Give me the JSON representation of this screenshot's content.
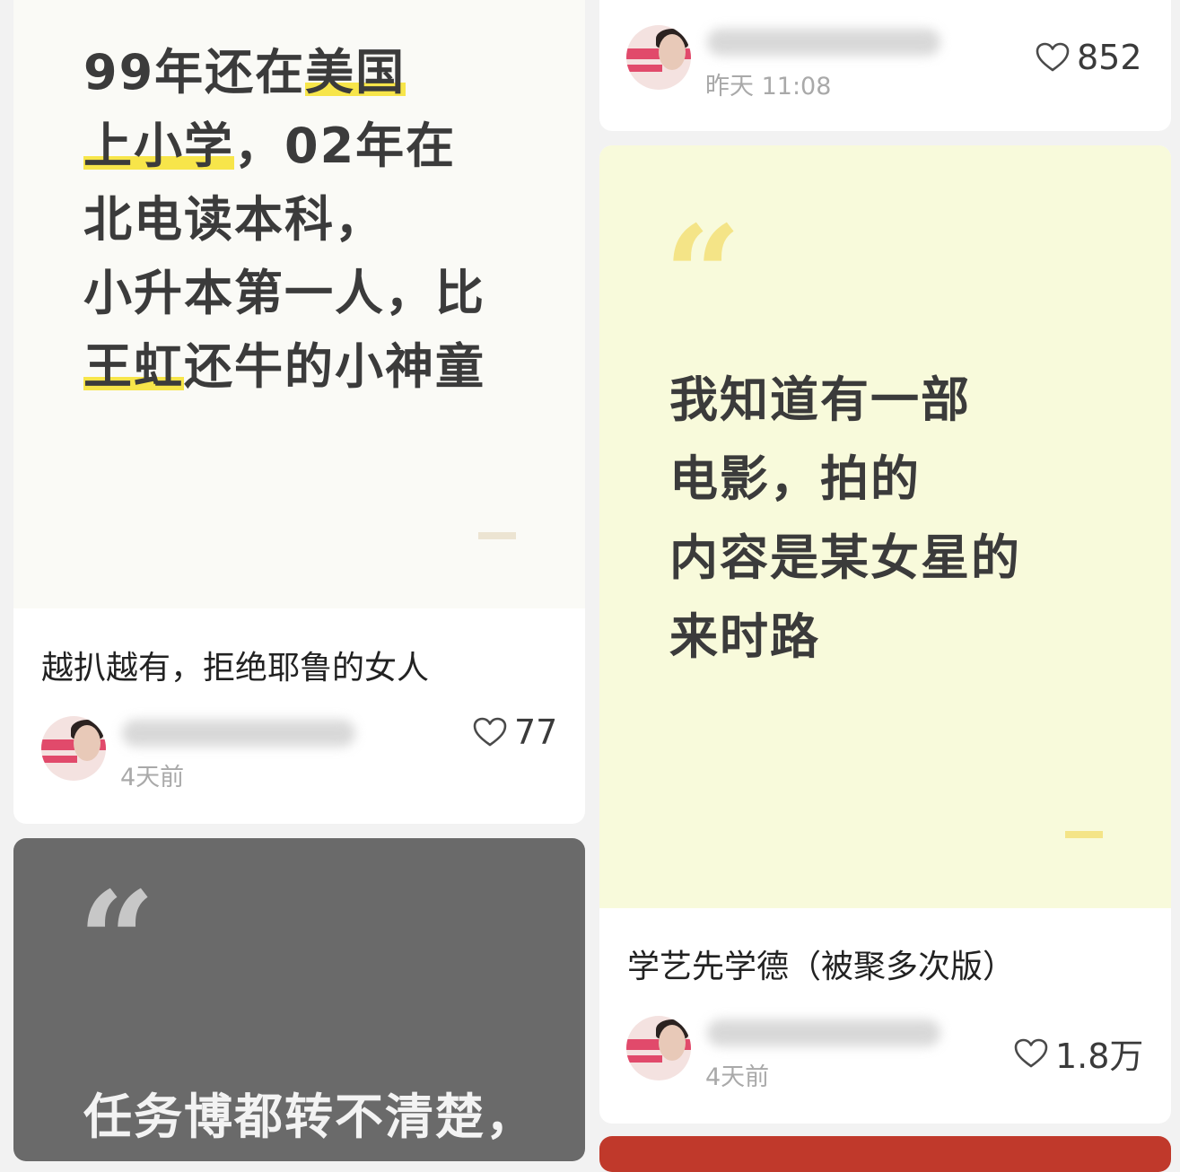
{
  "feed": {
    "left": {
      "card_note_1": {
        "cover_lines": [
          "99年还在",
          "美国",
          "上小学",
          "，02年在",
          "北电读本科，",
          "小升本第一人，比",
          "王虹",
          "还牛的小神童"
        ],
        "title": "越扒越有，拒绝耶鲁的女人",
        "time": "4天前",
        "likes": "77"
      },
      "card_note_2": {
        "quote_mark": "“",
        "cover_lines": [
          "任务博都转不清楚，"
        ]
      }
    },
    "right": {
      "card_note_3": {
        "time": "昨天 11:08",
        "likes": "852"
      },
      "card_note_4": {
        "quote_mark": "“",
        "cover_lines": [
          "我知道有一部",
          "电影，拍的",
          "内容是某女星的",
          "来时路"
        ],
        "title": "学艺先学德（被聚多次版）",
        "time": "4天前",
        "likes": "1.8万"
      }
    }
  },
  "colors": {
    "highlight": "#f7e54a",
    "quote_yellow": "#f4e487",
    "card_gray": "#6a6a6a",
    "cover_yellow": "#f8fadb"
  },
  "icons": {
    "like": "heart-outline-icon",
    "author_avatar": "avatar-image"
  }
}
